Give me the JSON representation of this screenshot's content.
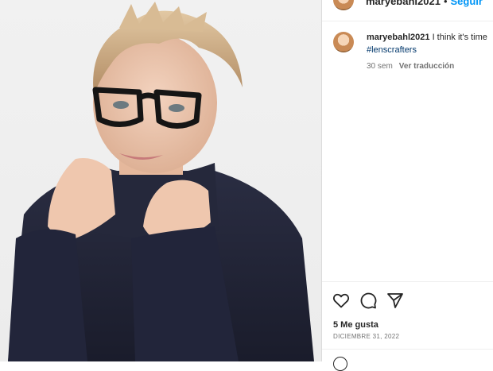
{
  "post": {
    "author": "maryebahl2021",
    "follow_label": "Seguir",
    "separator": "•"
  },
  "comment": {
    "username": "maryebahl2021",
    "text": "I think it's time",
    "hashtag": "#lenscrafters",
    "age": "30 sem",
    "translate_label": "Ver traducción"
  },
  "engagement": {
    "likes": "5 Me gusta",
    "date": "DICIEMBRE 31, 2022"
  },
  "icons": {
    "like": "heart-icon",
    "comment": "comment-icon",
    "share": "share-icon",
    "emoji": "emoji-icon"
  },
  "colors": {
    "link_blue": "#0095f6",
    "hashtag_blue": "#00376b",
    "muted": "#737373",
    "sweater": "#1f2235"
  }
}
